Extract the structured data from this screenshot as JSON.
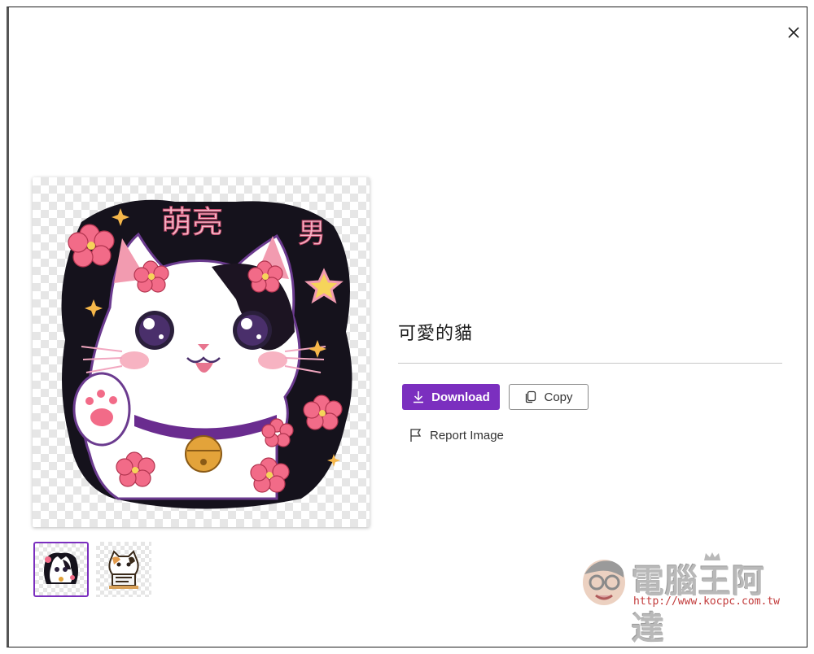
{
  "dialog": {
    "close_icon": "close-icon",
    "image_title": "可愛的貓",
    "actions": {
      "download_label": "Download",
      "download_icon": "download-icon",
      "copy_label": "Copy",
      "copy_icon": "copy-icon",
      "report_label": "Report Image",
      "report_icon": "flag-icon"
    },
    "main_image": {
      "sign_text_left": "萌亮",
      "sign_text_right": "男"
    },
    "thumbnails": [
      {
        "selected": true
      },
      {
        "selected": false
      }
    ]
  },
  "watermark": {
    "name": "電腦王阿達",
    "url": "http://www.kocpc.com.tw"
  },
  "colors": {
    "accent": "#7b2fbf",
    "divider": "#c8c8c8"
  }
}
